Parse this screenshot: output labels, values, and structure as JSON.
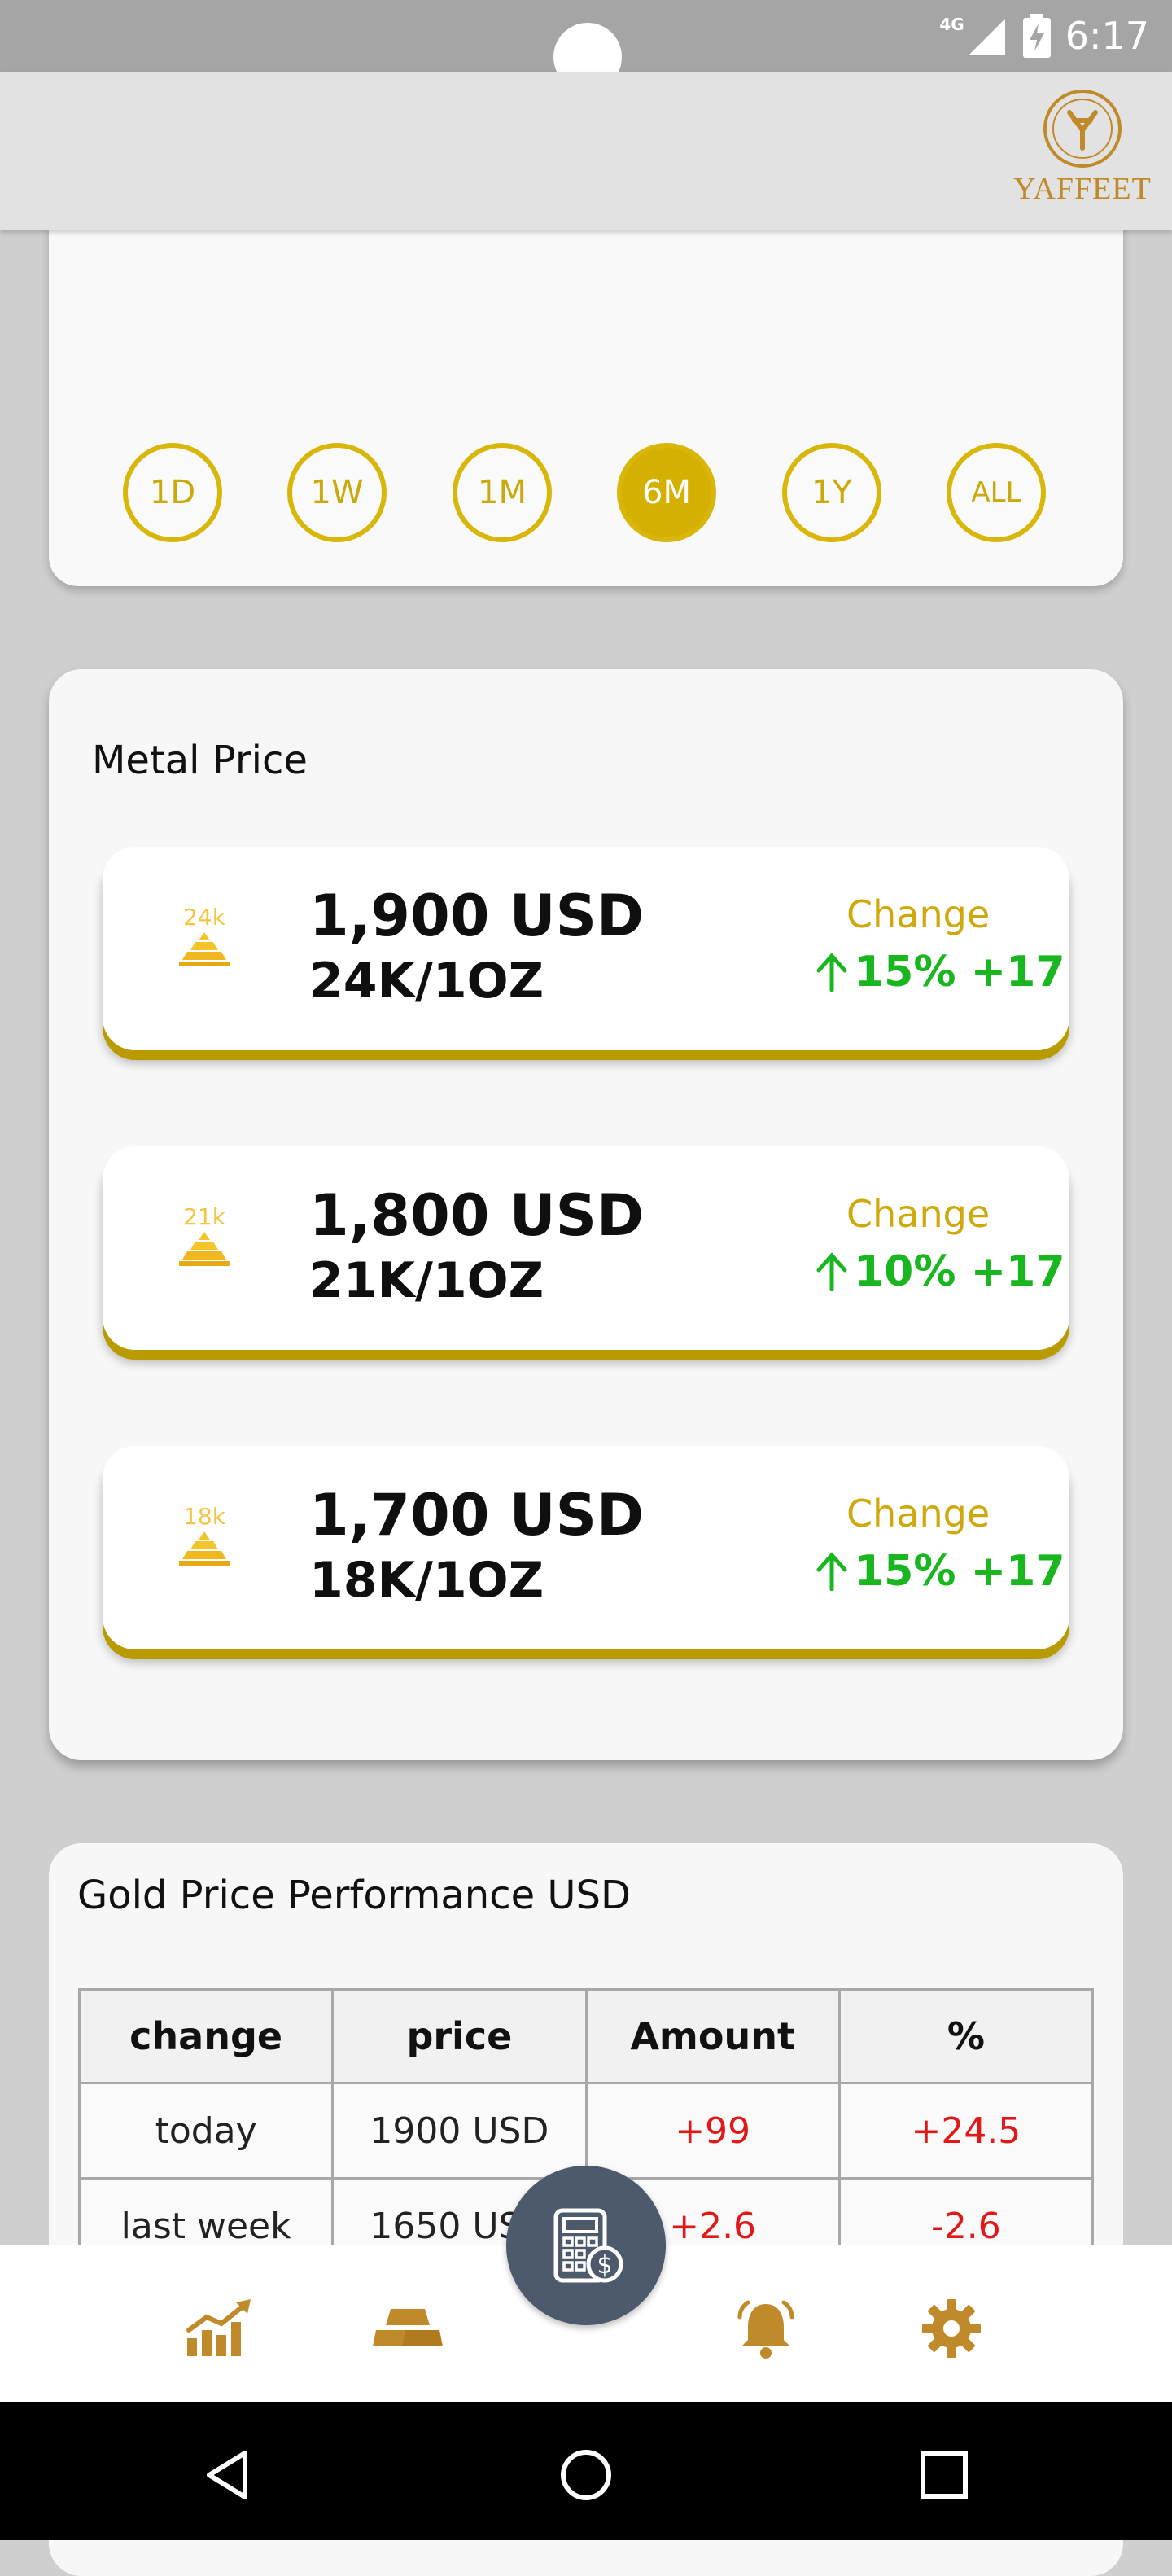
{
  "status_bar": {
    "time": "6:17",
    "network": "4G"
  },
  "app_bar": {
    "logo_text": "YAFFEET"
  },
  "periods": [
    {
      "label": "1D",
      "active": false
    },
    {
      "label": "1W",
      "active": false
    },
    {
      "label": "1M",
      "active": false
    },
    {
      "label": "6M",
      "active": true
    },
    {
      "label": "1Y",
      "active": false
    },
    {
      "label": "ALL",
      "active": false
    }
  ],
  "metal_price": {
    "title": "Metal Price",
    "items": [
      {
        "karat": "24k",
        "price": "1,900  USD",
        "unit": "24K/1OZ",
        "change_label": "Change",
        "change_value": "15% +17",
        "direction": "up"
      },
      {
        "karat": "21k",
        "price": "1,800  USD",
        "unit": "21K/1OZ",
        "change_label": "Change",
        "change_value": "10% +17",
        "direction": "up"
      },
      {
        "karat": "18k",
        "price": "1,700  USD",
        "unit": "18K/1OZ",
        "change_label": "Change",
        "change_value": "15% +17",
        "direction": "up"
      }
    ]
  },
  "performance": {
    "title": "Gold Price Performance USD",
    "headers": [
      "change",
      "price",
      "Amount",
      "%"
    ],
    "rows": [
      [
        "today",
        "1900 USD",
        "+99",
        "+24.5"
      ],
      [
        "last week",
        "1650  USD",
        "+2.6",
        "-2.6"
      ]
    ]
  },
  "bottom_nav": {
    "items": [
      "chart-icon",
      "gold-bars-icon",
      "calculator-icon",
      "bell-icon",
      "gear-icon"
    ]
  },
  "colors": {
    "gold": "#d4b000",
    "green": "#19b61f",
    "red": "#e01818",
    "fab": "#4d5a6b",
    "nav_icon": "#c08a2a"
  }
}
